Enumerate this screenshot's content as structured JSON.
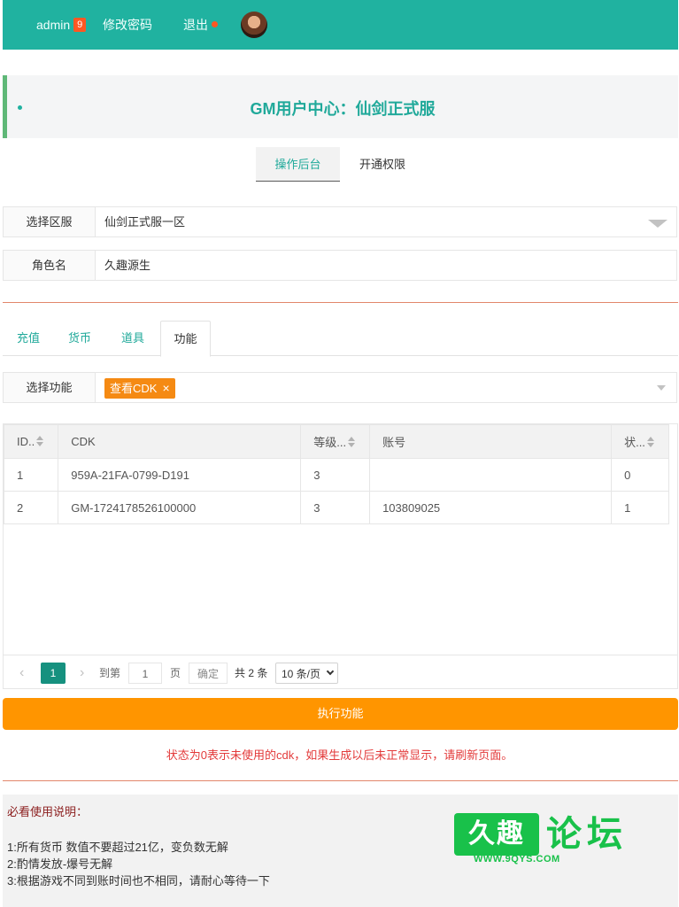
{
  "topbar": {
    "user": "admin",
    "user_badge": "9",
    "change_password": "修改密码",
    "logout": "退出"
  },
  "title": "GM用户中心：仙剑正式服",
  "top_tabs": [
    {
      "label": "操作后台",
      "active": true
    },
    {
      "label": "开通权限",
      "active": false
    }
  ],
  "server_row": {
    "label": "选择区服",
    "value": "仙剑正式服一区"
  },
  "role_row": {
    "label": "角色名",
    "value": "久趣源生"
  },
  "sub_tabs": [
    {
      "label": "充值",
      "active": false
    },
    {
      "label": "货币",
      "active": false
    },
    {
      "label": "道具",
      "active": false
    },
    {
      "label": "功能",
      "active": true
    }
  ],
  "func_row": {
    "label": "选择功能",
    "tag": "查看CDK",
    "tag_close": "×"
  },
  "table": {
    "headers": [
      "ID..",
      "CDK",
      "等级...",
      "账号",
      "状..."
    ],
    "rows": [
      [
        "1",
        "959A-21FA-0799-D191",
        "3",
        "",
        "0"
      ],
      [
        "2",
        "GM-1724178526100000",
        "3",
        "103809025",
        "1"
      ]
    ]
  },
  "pager": {
    "prev": "‹",
    "current": "1",
    "next": "›",
    "goto_label": "到第",
    "goto_value": "1",
    "page_label": "页",
    "confirm": "确定",
    "total": "共 2 条",
    "page_size": "10 条/页"
  },
  "execute_button": "执行功能",
  "notice": "状态为0表示未使用的cdk，如果生成以后未正常显示，请刷新页面。",
  "help": {
    "title": "必看使用说明：",
    "lines": [
      "1:所有货币 数值不要超过21亿，变负数无解",
      "2:酌情发放-爆号无解",
      "3:根据游戏不同到账时间也不相同，请耐心等待一下"
    ]
  },
  "watermark": {
    "box_text": "久趣",
    "text": "论坛",
    "url": "WWW.9QYS.COM"
  },
  "colors": {
    "header": "#20b2a0",
    "accent": "#20a99a",
    "badge": "#ff5722",
    "tag": "#f58a13",
    "execute": "#ff9500",
    "notice": "#e33a3a",
    "watermark": "#19c14a"
  }
}
